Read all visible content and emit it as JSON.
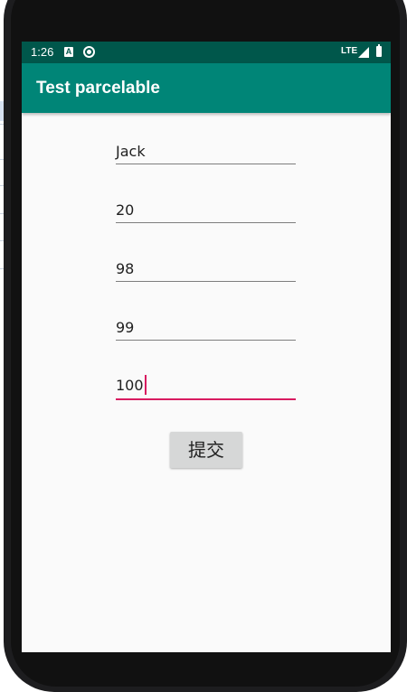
{
  "status_bar": {
    "time": "1:26",
    "network": "LTE",
    "notification_icons": [
      "accessibility-a-icon",
      "sync-icon"
    ],
    "signal_icon": "signal-icon",
    "battery_icon": "battery-icon"
  },
  "app_bar": {
    "title": "Test parcelable"
  },
  "form": {
    "fields": [
      {
        "value": "Jack"
      },
      {
        "value": "20"
      },
      {
        "value": "98"
      },
      {
        "value": "99"
      },
      {
        "value": "100",
        "focused": true
      }
    ],
    "submit_label": "提交"
  },
  "colors": {
    "status_bar": "#00574b",
    "app_bar": "#008577",
    "accent": "#d81b60",
    "background": "#fafafa"
  }
}
